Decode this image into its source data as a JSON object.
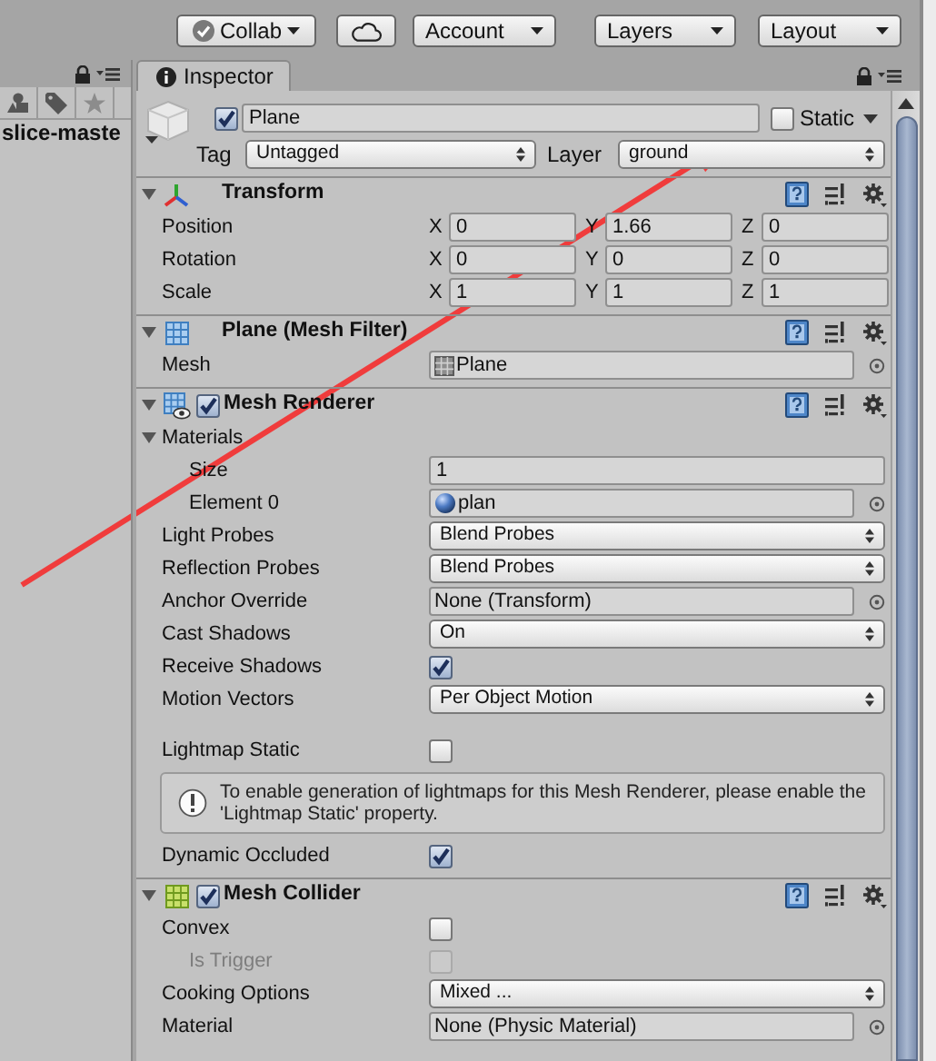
{
  "toolbar": [
    {
      "kind": "collab",
      "label": "Collab"
    },
    {
      "kind": "cloud"
    },
    {
      "kind": "dropdown",
      "label": "Account"
    },
    {
      "kind": "dropdown",
      "label": "Layers"
    },
    {
      "kind": "dropdown",
      "label": "Layout"
    }
  ],
  "hierarchy": {
    "title": "slice-maste"
  },
  "inspector": {
    "tab": "Inspector",
    "object": {
      "enabled": true,
      "name": "Plane",
      "static": false,
      "static_label": "Static",
      "tag_label": "Tag",
      "tag": "Untagged",
      "layer_label": "Layer",
      "layer": "ground"
    },
    "components": [
      {
        "title": "Transform",
        "kind": "transform",
        "expanded": true,
        "rows": [
          {
            "kind": "vector3",
            "label": "Position",
            "values": [
              {
                "axis": "X",
                "value": "0"
              },
              {
                "axis": "Y",
                "value": "1.66"
              },
              {
                "axis": "Z",
                "value": "0"
              }
            ]
          },
          {
            "kind": "vector3",
            "label": "Rotation",
            "values": [
              {
                "axis": "X",
                "value": "0"
              },
              {
                "axis": "Y",
                "value": "0"
              },
              {
                "axis": "Z",
                "value": "0"
              }
            ]
          },
          {
            "kind": "vector3",
            "label": "Scale",
            "values": [
              {
                "axis": "X",
                "value": "1"
              },
              {
                "axis": "Y",
                "value": "1"
              },
              {
                "axis": "Z",
                "value": "1"
              }
            ]
          }
        ]
      },
      {
        "title": "Plane (Mesh Filter)",
        "kind": "mesh_filter",
        "expanded": true,
        "rows": [
          {
            "kind": "mesh_object",
            "label": "Mesh",
            "value": "Plane"
          }
        ]
      },
      {
        "title": "Mesh Renderer",
        "kind": "mesh_renderer",
        "enabled": true,
        "expanded": true,
        "rows": [
          {
            "kind": "foldout",
            "label": "Materials",
            "expanded": true,
            "children": [
              {
                "kind": "text",
                "label": "Size",
                "value": "1"
              },
              {
                "kind": "material_object",
                "label": "Element 0",
                "value": "plan"
              }
            ]
          },
          {
            "kind": "dropdown",
            "label": "Light Probes",
            "value": "Blend Probes"
          },
          {
            "kind": "dropdown",
            "label": "Reflection Probes",
            "value": "Blend Probes"
          },
          {
            "kind": "object",
            "label": "Anchor Override",
            "value": "None (Transform)"
          },
          {
            "kind": "dropdown",
            "label": "Cast Shadows",
            "value": "On"
          },
          {
            "kind": "checkbox",
            "label": "Receive Shadows",
            "checked": true,
            "disabled": false
          },
          {
            "kind": "dropdown",
            "label": "Motion Vectors",
            "value": "Per Object Motion"
          },
          {
            "kind": "space"
          },
          {
            "kind": "checkbox",
            "label": "Lightmap Static",
            "checked": false,
            "disabled": false
          },
          {
            "kind": "helpbox",
            "text": "To enable generation of lightmaps for this Mesh Renderer, please enable the 'Lightmap Static' property."
          },
          {
            "kind": "checkbox",
            "label": "Dynamic Occluded",
            "checked": true,
            "disabled": false
          }
        ]
      },
      {
        "title": "Mesh Collider",
        "kind": "mesh_collider",
        "enabled": true,
        "expanded": true,
        "rows": [
          {
            "kind": "checkbox",
            "label": "Convex",
            "checked": false,
            "disabled": false,
            "children": [
              {
                "kind": "checkbox",
                "label": "Is Trigger",
                "checked": false,
                "disabled": true
              }
            ]
          },
          {
            "kind": "dropdown",
            "label": "Cooking Options",
            "value": "Mixed ..."
          },
          {
            "kind": "object",
            "label": "Material",
            "value": "None (Physic Material)"
          }
        ]
      }
    ]
  }
}
